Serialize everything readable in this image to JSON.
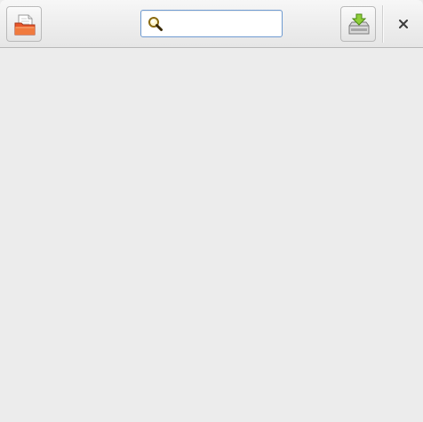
{
  "header": {
    "open_button": {
      "icon": "document-open-icon"
    },
    "search": {
      "icon": "search-icon",
      "value": "",
      "placeholder": ""
    },
    "save_button": {
      "icon": "download-save-icon"
    },
    "close_button": {
      "icon": "close-icon"
    }
  },
  "colors": {
    "background": "#ececec",
    "search_border": "#6f9bd1",
    "open_icon_accent": "#e8562a",
    "save_icon_accent": "#8fcf3a"
  }
}
